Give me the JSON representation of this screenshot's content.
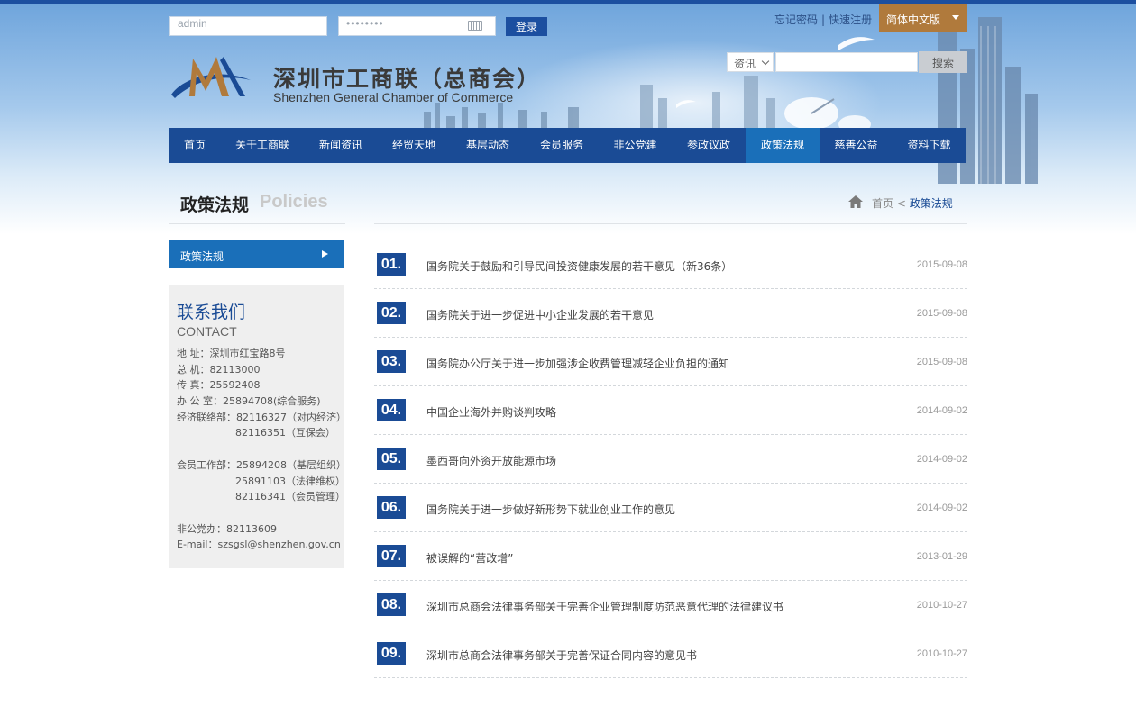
{
  "login": {
    "username": "admin",
    "password": "••••••••",
    "submit": "登录"
  },
  "top_links": {
    "forgot": "忘记密码",
    "sep": "|",
    "register": "快速注册"
  },
  "language": "简体中文版",
  "brand": {
    "title": "深圳市工商联（总商会）",
    "subtitle": "Shenzhen General Chamber of Commerce"
  },
  "search": {
    "category": "资讯",
    "button": "搜索"
  },
  "nav": [
    {
      "label": "首页",
      "active": false
    },
    {
      "label": "关于工商联",
      "active": false
    },
    {
      "label": "新闻资讯",
      "active": false
    },
    {
      "label": "经贸天地",
      "active": false
    },
    {
      "label": "基层动态",
      "active": false
    },
    {
      "label": "会员服务",
      "active": false
    },
    {
      "label": "非公党建",
      "active": false
    },
    {
      "label": "参政议政",
      "active": false
    },
    {
      "label": "政策法规",
      "active": true
    },
    {
      "label": "慈善公益",
      "active": false
    },
    {
      "label": "资料下载",
      "active": false
    }
  ],
  "section": {
    "title": "政策法规",
    "title_en": "Policies"
  },
  "breadcrumb": {
    "home": "首页",
    "sep": "<",
    "current": "政策法规"
  },
  "sidebar": {
    "active_item": "政策法规"
  },
  "contact": {
    "title": "联系我们",
    "title_en": "CONTACT",
    "address": "地 址：深圳市红宝路8号",
    "switchboard": "总 机：82113000",
    "fax": "传 真：25592408",
    "office": "办 公 室：25894708(综合服务)",
    "econ_1": "经济联络部：82116327（对内经济）",
    "econ_2": "82116351（互保会）",
    "member_1": "会员工作部：25894208（基层组织）",
    "member_2": "25891103（法律维权）",
    "member_3": "82116341（会员管理）",
    "party": "非公党办：82113609",
    "email": "E-mail：szsgsl@shenzhen.gov.cn"
  },
  "articles": [
    {
      "num": "01.",
      "title": "国务院关于鼓励和引导民间投资健康发展的若干意见（新36条）",
      "date": "2015-09-08"
    },
    {
      "num": "02.",
      "title": "国务院关于进一步促进中小企业发展的若干意见",
      "date": "2015-09-08"
    },
    {
      "num": "03.",
      "title": "国务院办公厅关于进一步加强涉企收费管理减轻企业负担的通知",
      "date": "2015-09-08"
    },
    {
      "num": "04.",
      "title": "中国企业海外并购谈判攻略",
      "date": "2014-09-02"
    },
    {
      "num": "05.",
      "title": "墨西哥向外资开放能源市场",
      "date": "2014-09-02"
    },
    {
      "num": "06.",
      "title": "国务院关于进一步做好新形势下就业创业工作的意见",
      "date": "2014-09-02"
    },
    {
      "num": "07.",
      "title": "被误解的“营改增”",
      "date": "2013-01-29"
    },
    {
      "num": "08.",
      "title": "深圳市总商会法律事务部关于完善企业管理制度防范恶意代理的法律建议书",
      "date": "2010-10-27"
    },
    {
      "num": "09.",
      "title": "深圳市总商会法律事务部关于完善保证合同内容的意见书",
      "date": "2010-10-27"
    }
  ],
  "colors": {
    "nav": "#1a4b95",
    "nav_active": "#1a6fb9",
    "lang": "#b07a3c"
  }
}
